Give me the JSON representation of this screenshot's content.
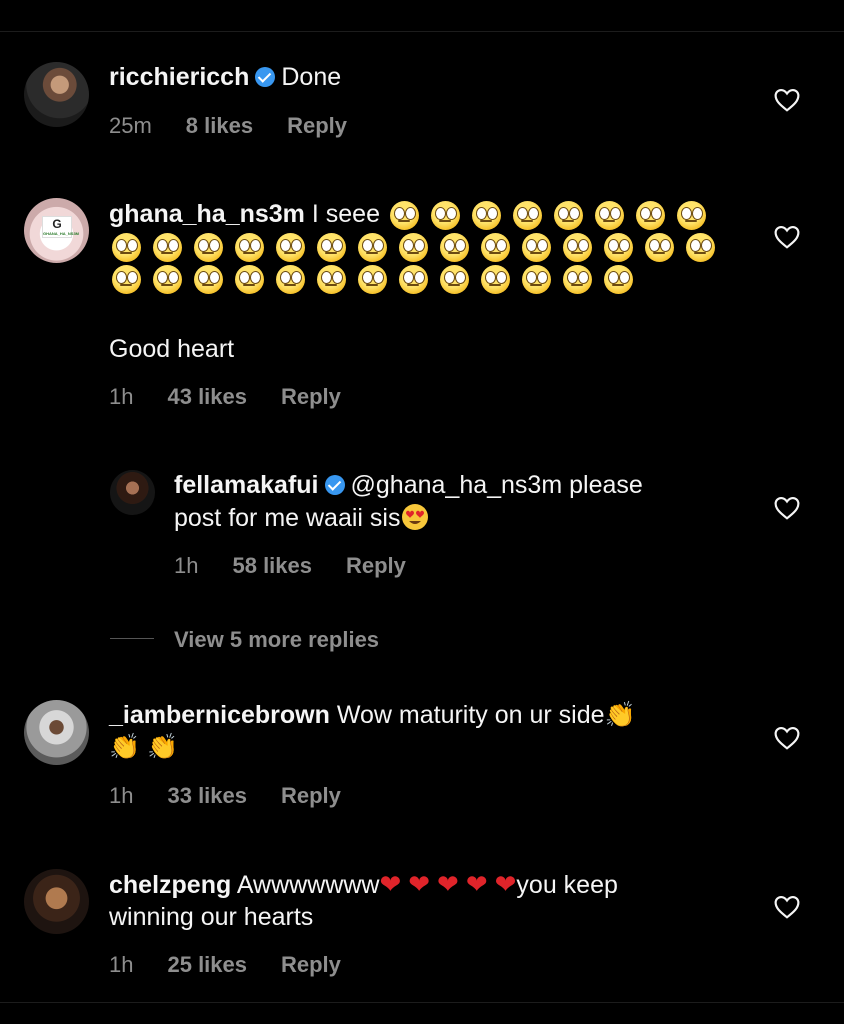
{
  "comments": [
    {
      "username": "ricchiericch",
      "verified": true,
      "text": "Done",
      "time": "25m",
      "likes": "8 likes",
      "reply": "Reply",
      "avatar_icon": "profile-photo"
    },
    {
      "username": "ghana_ha_ns3m",
      "verified": false,
      "text": "I seee",
      "emoji_name": "face-with-rolling-eyes",
      "emoji_count": 36,
      "text2": "Good heart",
      "time": "1h",
      "likes": "43 likes",
      "reply": "Reply",
      "avatar_icon": "logo-avatar",
      "logo_letter": "G",
      "logo_caption": "GHANA_HA_NS3M"
    },
    {
      "username": "fellamakafui",
      "verified": true,
      "text_line1": "@ghana_ha_ns3m please",
      "text_line2": "post for me waaii sis",
      "emoji_name": "heart-eyes-emoji",
      "time": "1h",
      "likes": "58 likes",
      "reply": "Reply",
      "avatar_icon": "profile-photo"
    },
    {
      "username": "_iambernicebrown",
      "verified": false,
      "text": "Wow maturity on ur side",
      "emoji_name": "clapping-hands-emoji",
      "emoji_char": "👏",
      "time": "1h",
      "likes": "33 likes",
      "reply": "Reply",
      "avatar_icon": "profile-photo"
    },
    {
      "username": "chelzpeng",
      "verified": false,
      "text": "Awwwwwww",
      "emoji_name": "red-heart-emoji",
      "emoji_char": "❤️",
      "text_after": "you keep",
      "text2": "winning our hearts",
      "time": "1h",
      "likes": "25 likes",
      "reply": "Reply",
      "avatar_icon": "profile-photo"
    }
  ],
  "view_more": "View 5 more replies",
  "colors": {
    "background": "#000000",
    "text": "#f5f5f5",
    "meta": "#8e8e8e",
    "verified": "#3897f0",
    "heart": "#e0242a"
  }
}
